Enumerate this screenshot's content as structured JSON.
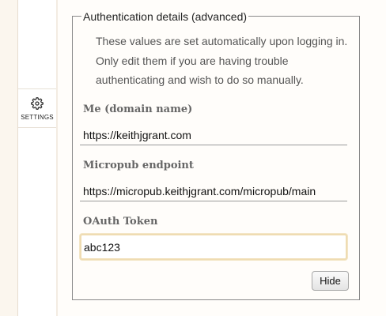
{
  "sidebar": {
    "settings_label": "SETTINGS",
    "settings_icon": "gear-icon"
  },
  "auth": {
    "legend": "Authentication details (advanced)",
    "help_lines": [
      "These values are set automatically upon logging in.",
      "Only edit them if you are having trouble",
      "authenticating and wish to do so manually."
    ],
    "me": {
      "label": "Me (domain name)",
      "value": "https://keithjgrant.com"
    },
    "micropub": {
      "label": "Micropub endpoint",
      "value": "https://micropub.keithjgrant.com/micropub/main"
    },
    "oauth": {
      "label": "OAuth Token",
      "value": "abc123"
    },
    "hide_button": "Hide"
  },
  "colors": {
    "focus_border": "#efdcb2",
    "sidebar_bg": "#fbf6ee"
  }
}
